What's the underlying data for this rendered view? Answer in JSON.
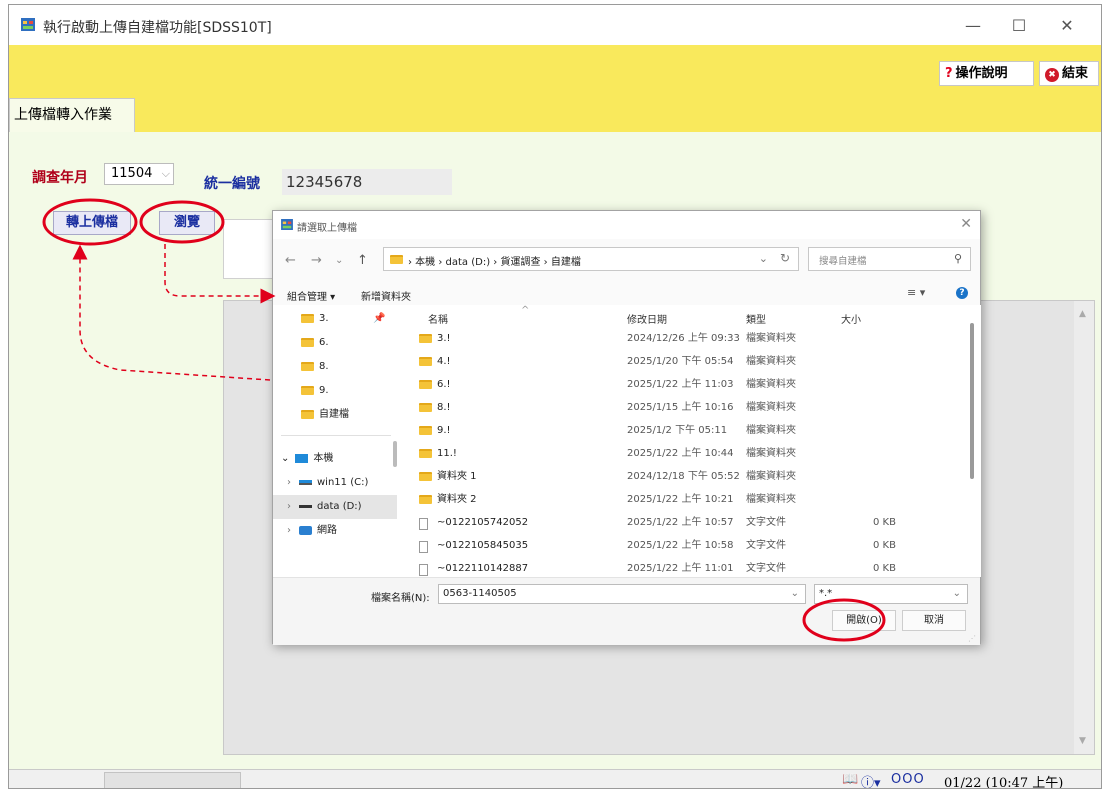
{
  "window": {
    "title": "執行啟動上傳自建檔功能[SDSS10T]",
    "minimize": "—",
    "maximize": "☐",
    "close": "✕"
  },
  "toolbar": {
    "help_icon": "?",
    "help_label": "操作說明",
    "exit_icon": "✖",
    "exit_label": "結束"
  },
  "tab": {
    "label": "上傳檔轉入作業"
  },
  "form": {
    "year_label": "調查年月",
    "year_value": "11504",
    "taxid_label": "統一編號",
    "taxid_value": "12345678",
    "upload_button": "轉上傳檔",
    "browse_button": "瀏覽"
  },
  "dialog": {
    "title": "請選取上傳檔",
    "path": "› 本機 › data (D:) › 貨運調查 › 自建檔",
    "search_placeholder": "搜尋自建檔",
    "organize": "組合管理 ▾",
    "new_folder": "新增資料夾",
    "columns": {
      "name": "名稱",
      "date": "修改日期",
      "type": "類型",
      "size": "大小"
    },
    "nav_items": [
      {
        "label": "3.",
        "icon": "folder-icon",
        "pinned": true
      },
      {
        "label": "6.",
        "icon": "folder-icon",
        "pinned": false
      },
      {
        "label": "8.",
        "icon": "folder-icon",
        "pinned": false
      },
      {
        "label": "9.",
        "icon": "folder-icon",
        "pinned": false
      },
      {
        "label": "自建檔",
        "icon": "folder-icon",
        "pinned": false
      },
      {
        "label": "本機",
        "icon": "pc-icon",
        "chevron": "⌄"
      },
      {
        "label": "win11 (C:)",
        "icon": "drive-icon",
        "chevron": "›"
      },
      {
        "label": "data (D:)",
        "icon": "drive-icon",
        "chevron": "›"
      },
      {
        "label": "網路",
        "icon": "network-icon",
        "chevron": "›"
      }
    ],
    "files": [
      {
        "name": "3.!",
        "date": "2024/12/26 上午 09:33",
        "type": "檔案資料夾",
        "size": "",
        "kind": "folder"
      },
      {
        "name": "4.!",
        "date": "2025/1/20 下午 05:54",
        "type": "檔案資料夾",
        "size": "",
        "kind": "folder"
      },
      {
        "name": "6.!",
        "date": "2025/1/22 上午 11:03",
        "type": "檔案資料夾",
        "size": "",
        "kind": "folder"
      },
      {
        "name": "8.!",
        "date": "2025/1/15 上午 10:16",
        "type": "檔案資料夾",
        "size": "",
        "kind": "folder"
      },
      {
        "name": "9.!",
        "date": "2025/1/2 下午 05:11",
        "type": "檔案資料夾",
        "size": "",
        "kind": "folder"
      },
      {
        "name": "11.!",
        "date": "2025/1/22 上午 10:44",
        "type": "檔案資料夾",
        "size": "",
        "kind": "folder"
      },
      {
        "name": "資料夾 1",
        "date": "2024/12/18 下午 05:52",
        "type": "檔案資料夾",
        "size": "",
        "kind": "folder"
      },
      {
        "name": "資料夾 2",
        "date": "2025/1/22 上午 10:21",
        "type": "檔案資料夾",
        "size": "",
        "kind": "folder"
      },
      {
        "name": "~0122105742052",
        "date": "2025/1/22 上午 10:57",
        "type": "文字文件",
        "size": "0 KB",
        "kind": "file"
      },
      {
        "name": "~0122105845035",
        "date": "2025/1/22 上午 10:58",
        "type": "文字文件",
        "size": "0 KB",
        "kind": "file"
      },
      {
        "name": "~0122110142887",
        "date": "2025/1/22 上午 11:01",
        "type": "文字文件",
        "size": "0 KB",
        "kind": "file"
      }
    ],
    "filename_label": "檔案名稱(N):",
    "filename_value": "0563-1140505",
    "filetype_value": "*.*",
    "open_button": "開啟(O)",
    "cancel_button": "取消"
  },
  "status": {
    "user": "OOO",
    "datetime": "01/22 (10:47 上午)"
  },
  "colors": {
    "toolbar_bg": "#f9e95c",
    "annotation": "#e0001b",
    "label_red": "#b0001a",
    "label_blue": "#1b2fa0"
  }
}
